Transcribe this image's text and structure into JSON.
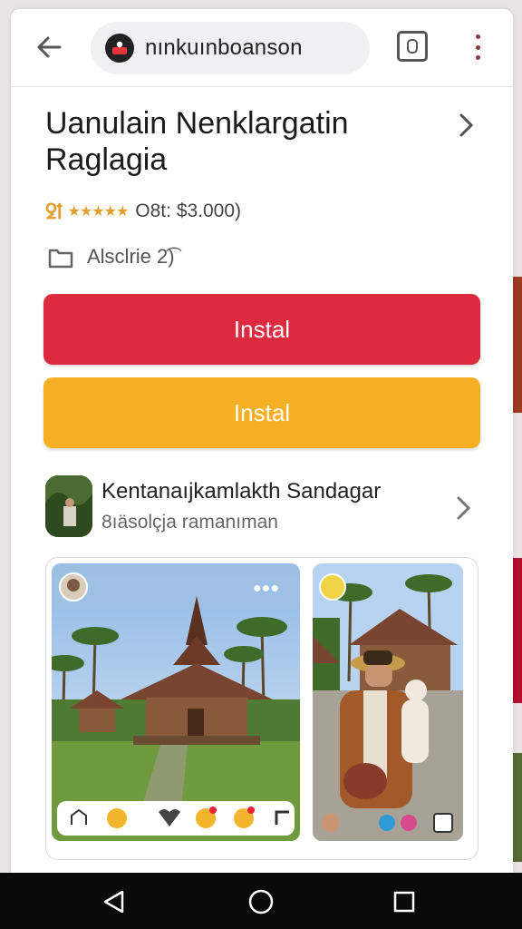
{
  "browser": {
    "url_text": "nınkuınboanson"
  },
  "app": {
    "title": "Uanulain Nenklargatin Raglagia",
    "rating_badge": "ꝿꝉ",
    "rating_stars": "★★★★★",
    "rating_text": "O8t: $3.000)",
    "age_text": "Alsclrie 2͡)",
    "install_primary": "Instal",
    "install_secondary": "Instal"
  },
  "developer": {
    "name": "Kentanaıjkamlakth  Sandagar",
    "subtitle": "8ıäsolçja ramanıman"
  },
  "screenshots": {
    "items": [
      "temple-village-screenshot",
      "villager-portrait-screenshot"
    ]
  },
  "colors": {
    "install_red": "#dd2a3e",
    "install_orange": "#f7b023",
    "rating_gold": "#e0a030"
  },
  "icons": [
    "back-arrow-icon",
    "site-icon",
    "tab-switcher-icon",
    "more-vert-icon",
    "chevron-right-icon",
    "calendar-icon",
    "nav-back-icon",
    "nav-home-icon",
    "nav-recents-icon"
  ]
}
